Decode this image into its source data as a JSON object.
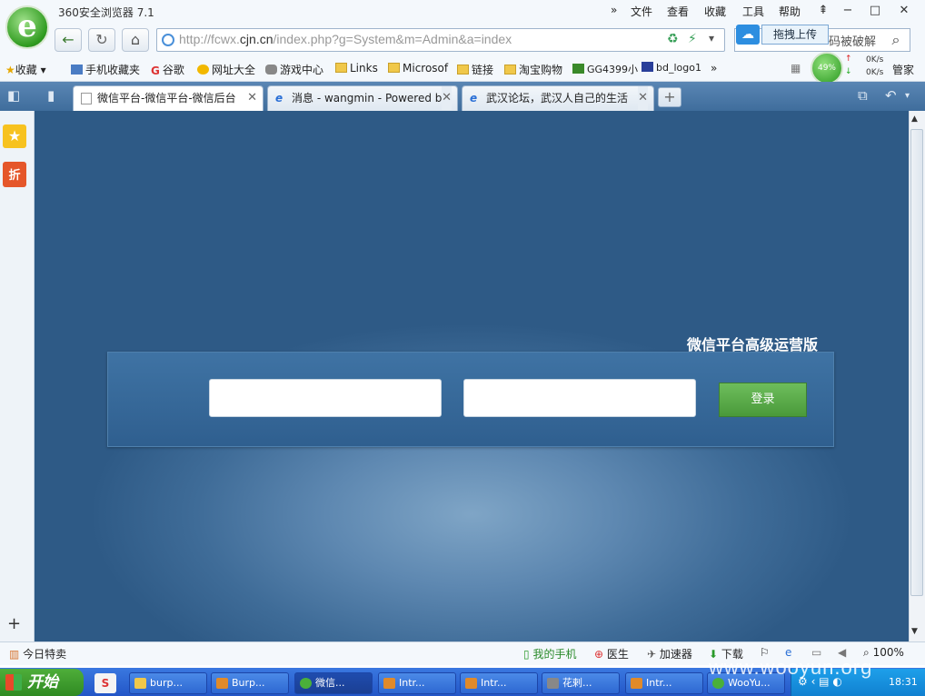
{
  "window": {
    "app_title": "360安全浏览器 7.1",
    "menu": [
      "文件",
      "查看",
      "收藏",
      "工具",
      "帮助"
    ],
    "logo_letter": "e"
  },
  "nav": {
    "url_host_pre": "http://fcwx.",
    "url_host": "cjn.cn",
    "url_path": "/index.php?g=System&m=Admin&a=index",
    "upload_label": "拖拽上传",
    "search_hint": "码被破解"
  },
  "bookmarks": {
    "favorites": "收藏",
    "items": [
      "手机收藏夹",
      "谷歌",
      "网址大全",
      "游戏中心",
      "Links",
      "Microsof",
      "链接",
      "淘宝购物",
      "GG4399小",
      "bd_logo1"
    ],
    "more": "»",
    "manager": "管家",
    "speed_percent": "49%",
    "up_speed": "0K/s",
    "down_speed": "0K/s"
  },
  "tabs": [
    {
      "label": "微信平台-微信平台-微信后台"
    },
    {
      "label": "消息 - wangmin - Powered by"
    },
    {
      "label": "武汉论坛，武汉人自己的生活"
    }
  ],
  "page": {
    "brand": "微信平台高级运营版",
    "username_value": "",
    "password_value": "",
    "login_label": "登录"
  },
  "sidebar": {
    "sale_label": "折",
    "add_label": "+"
  },
  "statusbar": {
    "left": "今日特卖",
    "items": [
      "我的手机",
      "医生",
      "加速器",
      "下载"
    ],
    "zoom": "100%"
  },
  "taskbar": {
    "start": "开始",
    "tasks": [
      "burp...",
      "Burp...",
      "微信...",
      "Intr...",
      "Intr...",
      "花剌...",
      "Intr...",
      "WooYu..."
    ],
    "clock": "18:31",
    "watermark": "www.wooyun.org"
  },
  "colors": {
    "page_bg": "#3f6c98",
    "login_button": "#5aa848",
    "taskbar": "#2f64d0"
  }
}
